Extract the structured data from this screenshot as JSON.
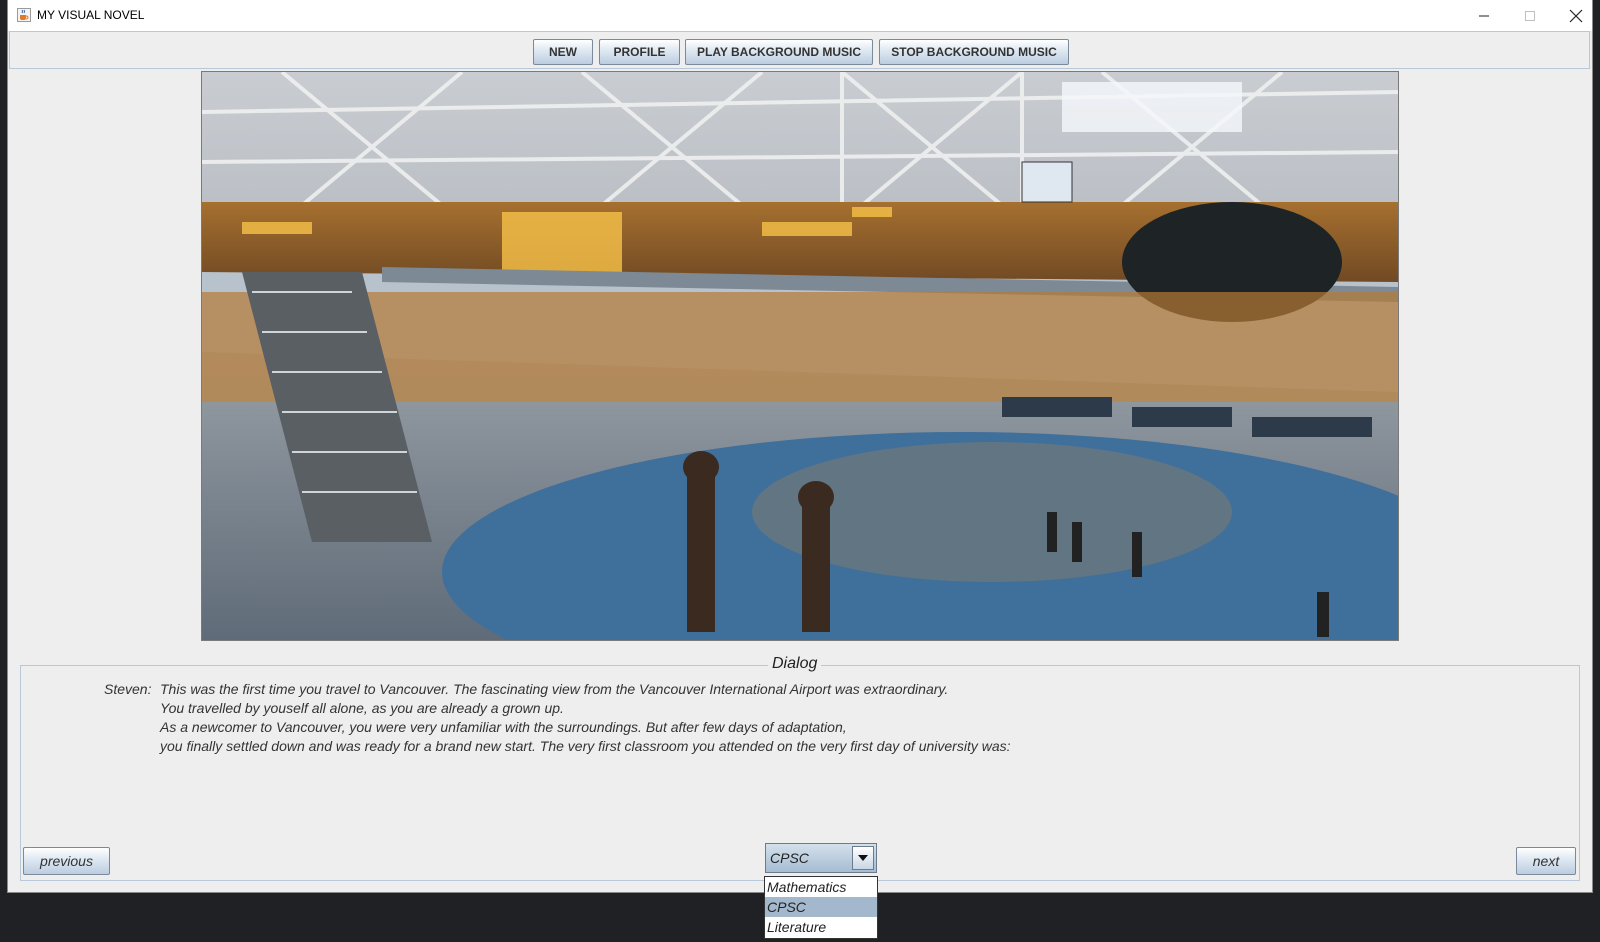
{
  "window": {
    "title": "MY VISUAL NOVEL",
    "icon": "java-coffee-icon"
  },
  "toolbar": {
    "buttons": [
      "NEW",
      "PROFILE",
      "PLAY BACKGROUND MUSIC",
      "STOP BACKGROUND MUSIC"
    ]
  },
  "scene": {
    "description_icon": "airport-terminal-scene"
  },
  "dialog": {
    "title": "Dialog",
    "speaker": "Steven:",
    "lines": [
      "This was the first time you travel to Vancouver. The fascinating view from the Vancouver International Airport was extraordinary.",
      "You travelled by youself all alone, as you are already a grown up.",
      "As a newcomer to Vancouver, you were very unfamiliar with the surroundings. But after few days of adaptation,",
      "you finally settled down and was ready for a brand new start. The very first classroom you attended on the very first day of university was:"
    ]
  },
  "nav": {
    "previous": "previous",
    "next": "next"
  },
  "choice": {
    "selected": "CPSC",
    "options": [
      "Mathematics",
      "CPSC",
      "Literature"
    ]
  },
  "colors": {
    "accent": "#a3b8cc",
    "window_bg": "#eeeeee",
    "desktop_bg": "#202124"
  }
}
